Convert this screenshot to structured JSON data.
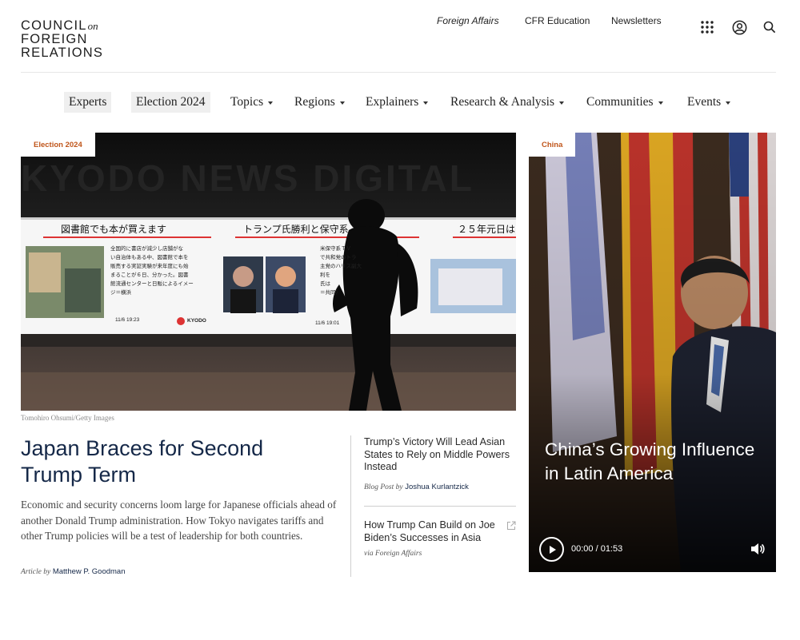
{
  "header": {
    "logo_line1": "COUNCIL",
    "logo_on": "on",
    "logo_line2": "FOREIGN",
    "logo_line3": "RELATIONS",
    "links": [
      "Foreign Affairs",
      "CFR Education",
      "Newsletters"
    ],
    "icons": [
      "apps-grid-icon",
      "account-icon",
      "search-icon"
    ]
  },
  "nav": {
    "items": [
      {
        "label": "Experts",
        "dropdown": false,
        "highlight": true
      },
      {
        "label": "Election 2024",
        "dropdown": false,
        "highlight": true
      },
      {
        "label": "Topics",
        "dropdown": true
      },
      {
        "label": "Regions",
        "dropdown": true
      },
      {
        "label": "Explainers",
        "dropdown": true
      },
      {
        "label": "Research & Analysis",
        "dropdown": true
      },
      {
        "label": "Communities",
        "dropdown": true
      },
      {
        "label": "Events",
        "dropdown": true
      }
    ]
  },
  "hero": {
    "tag": "Election 2024",
    "image_credit": "Tomohiro Ohsumi/Getty Images",
    "billboard_text": {
      "brand": "KYODO NEWS DIGITAL",
      "left_headline": "図書館でも本が買えます",
      "mid_headline": "トランプ氏勝利と保守系",
      "right_headline": "２５年元日は",
      "left_body": [
        "全国的に書店が減少し店舗がな",
        "い自治体もある中、図書館で本を",
        "販売する実証実験が来年度にも始",
        "まることが６日、分かった。図書",
        "館流通センターと日販によるイメー",
        "ジ＝横浜"
      ],
      "mid_body": [
        "米保守系ＴＶ",
        "で共和党のトラ",
        "主党のハリス副大",
        "利を",
        "氏は",
        "＝共同）"
      ],
      "time_left": "11/6 19:23",
      "time_mid": "11/6 19:01",
      "logo_small": "KYODO"
    },
    "headline": "Japan Braces for Second Trump Term",
    "dek": "Economic and security concerns loom large for Japanese officials ahead of another Donald Trump administration. How Tokyo navigates tariffs and other Trump policies will be a test of leadership for both countries.",
    "byline_prefix": "Article by",
    "byline_author": "Matthew P. Goodman"
  },
  "side_stories": [
    {
      "title": "Trump’s Victory Will Lead Asian States to Rely on Middle Powers Instead",
      "byline_prefix": "Blog Post by",
      "byline_author": "Joshua Kurlantzick"
    },
    {
      "title": "How Trump Can Build on Joe Biden’s Successes in Asia",
      "byline_prefix": "via Foreign Affairs",
      "byline_author": "",
      "external": true
    }
  ],
  "video_card": {
    "tag": "China",
    "title": "China’s Growing Influence in Latin America",
    "time": "00:00 / 01:53"
  },
  "colors": {
    "accent_orange": "#c0561b",
    "navy": "#152848"
  }
}
